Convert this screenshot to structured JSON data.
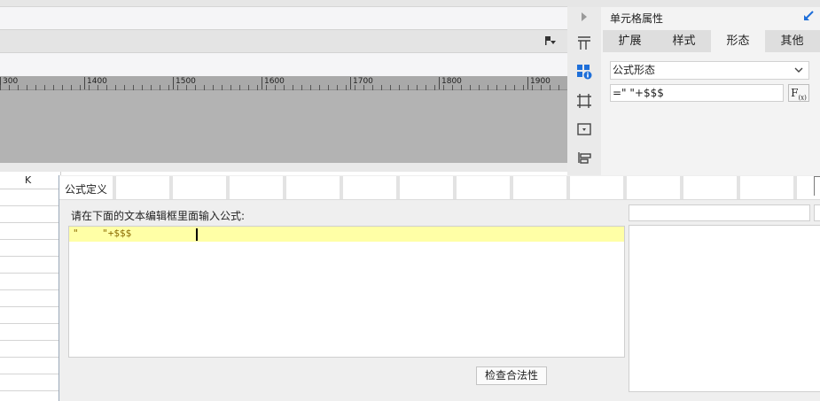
{
  "ruler": {
    "marks": [
      "300",
      "1400",
      "1500",
      "1600",
      "1700",
      "1800",
      "1900"
    ]
  },
  "sheet": {
    "column_label": "K"
  },
  "panel": {
    "title": "单元格属性",
    "tabs": [
      "扩展",
      "样式",
      "形态",
      "其他"
    ],
    "active_tab": "形态",
    "shape_select_value": "公式形态",
    "formula_value": "=\"   \"+$$$",
    "fx_label": "F",
    "fx_sub": "(x)"
  },
  "dialog": {
    "title": "公式定义",
    "prompt": "请在下面的文本编辑框里面输入公式:",
    "editor_text": "\"    \"+$$$",
    "check_button": "检查合法性"
  },
  "colors": {
    "editor_highlight": "#ffffa6",
    "accent_blue": "#1e6fd9"
  }
}
